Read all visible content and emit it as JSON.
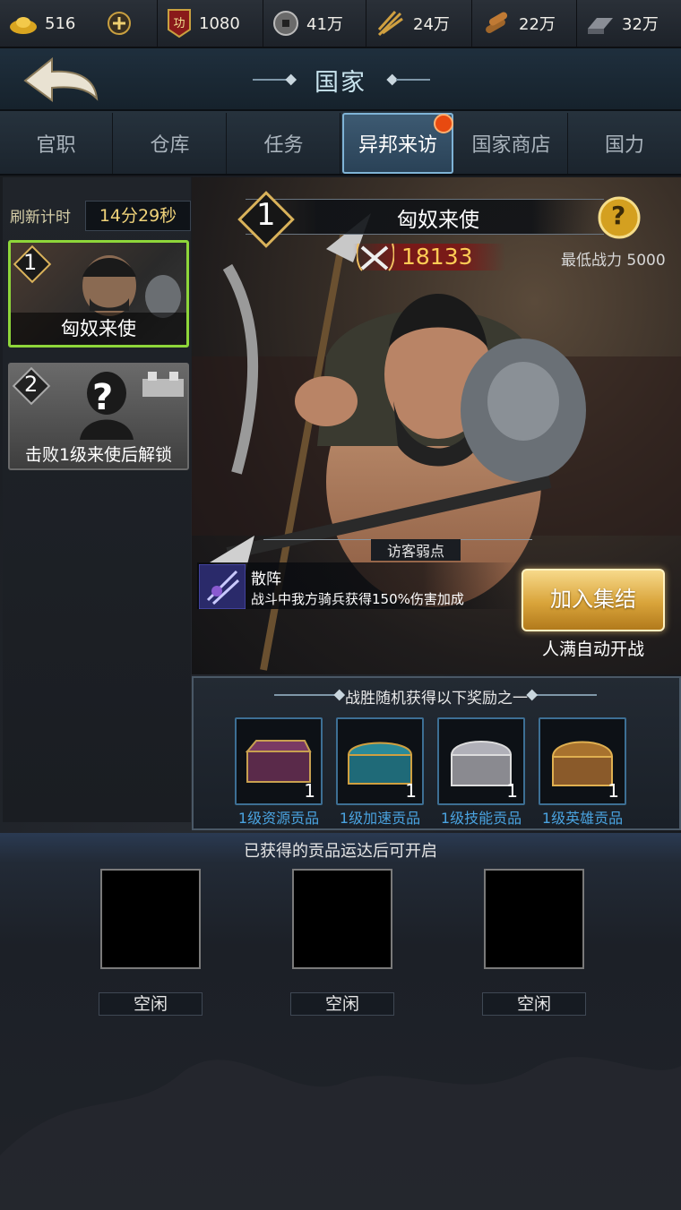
{
  "resources": [
    {
      "name": "gold-ingot",
      "value": "516"
    },
    {
      "name": "merit",
      "value": "1080",
      "badge": "功"
    },
    {
      "name": "copper-coin",
      "value": "41万"
    },
    {
      "name": "grain",
      "value": "24万"
    },
    {
      "name": "wood",
      "value": "22万"
    },
    {
      "name": "iron",
      "value": "32万"
    }
  ],
  "header": {
    "title": "国家"
  },
  "tabs": [
    {
      "label": "官职"
    },
    {
      "label": "仓库"
    },
    {
      "label": "任务"
    },
    {
      "label": "异邦来访",
      "active": true,
      "has_notice": true
    },
    {
      "label": "国家商店"
    },
    {
      "label": "国力"
    }
  ],
  "refresh": {
    "label": "刷新计时",
    "timer": "14分29秒"
  },
  "visitors": [
    {
      "level": "1",
      "name": "匈奴来使",
      "selected": true
    },
    {
      "level": "2",
      "name": "击败1级来使后解锁",
      "locked": true,
      "mystery": "?"
    }
  ],
  "envoy": {
    "level": "1",
    "name": "匈奴来使",
    "power": "18133",
    "min_power": "最低战力 5000",
    "help": "?"
  },
  "weakness": {
    "header": "访客弱点",
    "skill_name": "散阵",
    "skill_desc": "战斗中我方骑兵获得150%伤害加成"
  },
  "join": {
    "button": "加入集结",
    "hint": "人满自动开战"
  },
  "rewards": {
    "header": "战胜随机获得以下奖励之一",
    "items": [
      {
        "label": "1级资源贡品",
        "count": "1",
        "color": "#5a2a4a"
      },
      {
        "label": "1级加速贡品",
        "count": "1",
        "color": "#1f6a78"
      },
      {
        "label": "1级技能贡品",
        "count": "1",
        "color": "#9a9aa0"
      },
      {
        "label": "1级英雄贡品",
        "count": "1",
        "color": "#8a5a2a"
      }
    ]
  },
  "tribute": {
    "header": "已获得的贡品运达后可开启",
    "slots": [
      {
        "status": "空闲"
      },
      {
        "status": "空闲"
      },
      {
        "status": "空闲"
      }
    ]
  },
  "colors": {
    "accent_gold": "#e8c46a",
    "power_red": "#ffcc55",
    "link_blue": "#4aa3e0"
  }
}
